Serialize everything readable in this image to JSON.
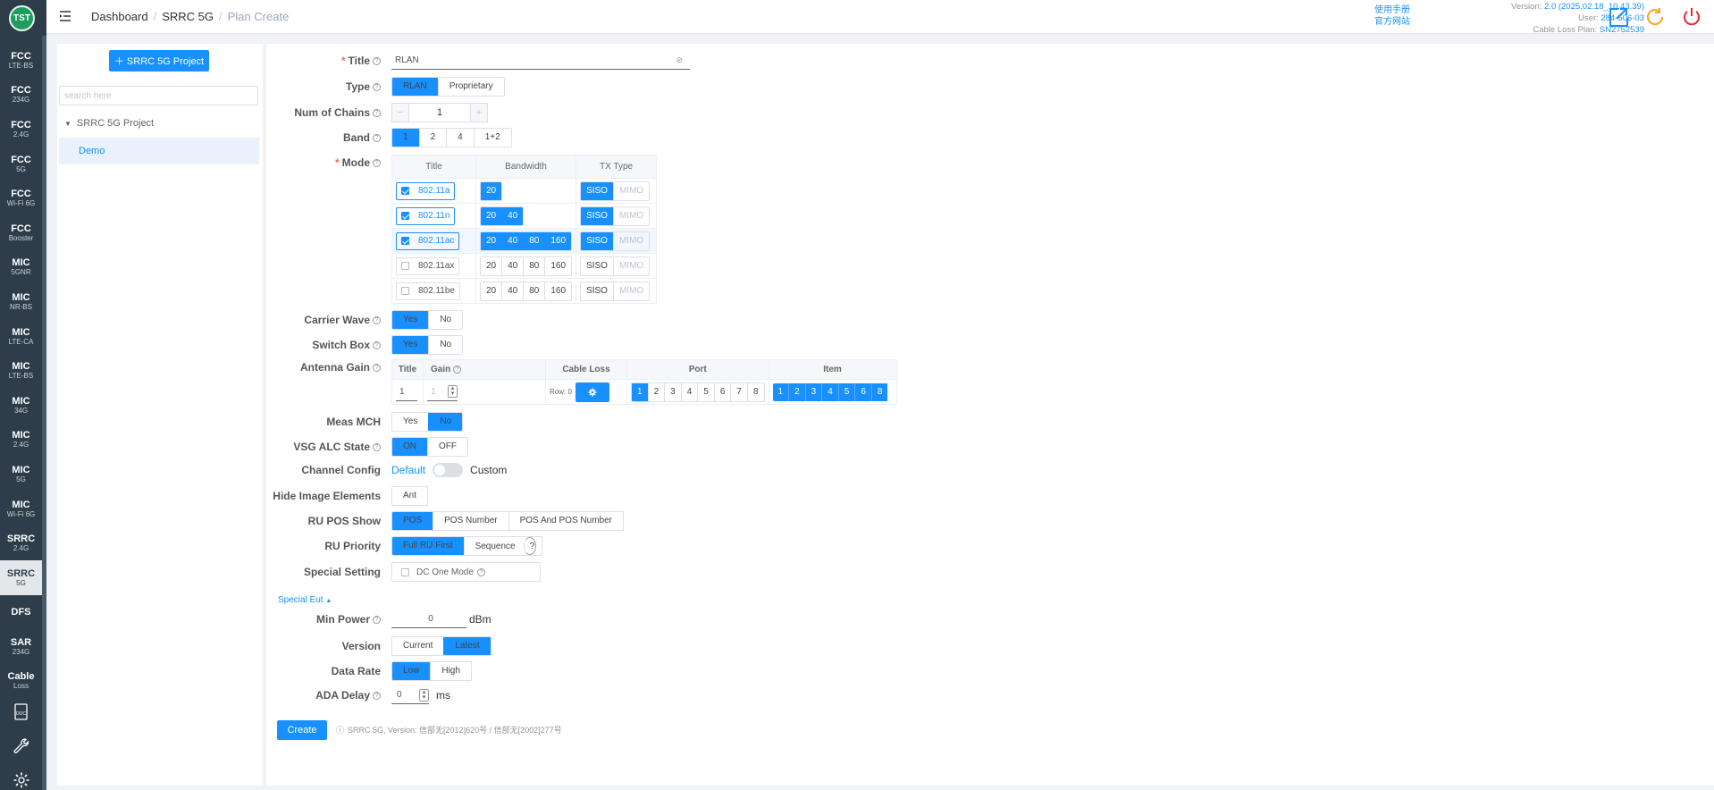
{
  "app": {
    "logo": "TST"
  },
  "nav": {
    "items": [
      {
        "l1": "FCC",
        "l2": "LTE-BS"
      },
      {
        "l1": "FCC",
        "l2": "234G"
      },
      {
        "l1": "FCC",
        "l2": "2.4G"
      },
      {
        "l1": "FCC",
        "l2": "5G"
      },
      {
        "l1": "FCC",
        "l2": "Wi-Fi 6G"
      },
      {
        "l1": "FCC",
        "l2": "Booster"
      },
      {
        "l1": "MIC",
        "l2": "5GNR"
      },
      {
        "l1": "MIC",
        "l2": "NR-BS"
      },
      {
        "l1": "MIC",
        "l2": "LTE-CA"
      },
      {
        "l1": "MIC",
        "l2": "LTE-BS"
      },
      {
        "l1": "MIC",
        "l2": "34G"
      },
      {
        "l1": "MIC",
        "l2": "2.4G"
      },
      {
        "l1": "MIC",
        "l2": "5G"
      },
      {
        "l1": "MIC",
        "l2": "Wi-Fi 6G"
      },
      {
        "l1": "SRRC",
        "l2": "2.4G"
      },
      {
        "l1": "SRRC",
        "l2": "5G"
      },
      {
        "l1": "DFS",
        "l2": ""
      },
      {
        "l1": "SAR",
        "l2": "234G"
      },
      {
        "l1": "Cable",
        "l2": "Loss"
      }
    ],
    "icons": [
      "doc-icon",
      "wrench-icon",
      "gear-icon"
    ],
    "doc_label": "DOC"
  },
  "header": {
    "breadcrumb": [
      "Dashboard",
      "SRRC 5G",
      "Plan Create"
    ],
    "links": [
      "使用手册",
      "官方网站"
    ],
    "meta": [
      {
        "k": "Version:",
        "v": "2.0 (2025.02.18_10.43.39)"
      },
      {
        "k": "User:",
        "v": "284-506-03"
      },
      {
        "k": "Cable Loss Plan:",
        "v": "SN2752539"
      }
    ]
  },
  "tree": {
    "add_label": "SRRC 5G Project",
    "search_placeholder": "search here",
    "node": "SRRC 5G Project",
    "leaf": "Demo"
  },
  "form": {
    "title": {
      "label": "Title",
      "value": "RLAN"
    },
    "type": {
      "label": "Type",
      "options": [
        "RLAN",
        "Proprietary"
      ],
      "selected": 0
    },
    "chains": {
      "label": "Num of Chains",
      "value": "1"
    },
    "band": {
      "label": "Band",
      "options": [
        "1",
        "2",
        "4",
        "1+2"
      ],
      "selected": 0
    },
    "mode": {
      "label": "Mode",
      "headers": [
        "Title",
        "Bandwidth",
        "TX Type"
      ],
      "rows": [
        {
          "title": "802.11a",
          "checked": true,
          "bw": [
            "20"
          ],
          "bw_on": [
            true
          ],
          "tx_on": [
            true,
            false
          ]
        },
        {
          "title": "802.11n",
          "checked": true,
          "bw": [
            "20",
            "40"
          ],
          "bw_on": [
            true,
            true
          ],
          "tx_on": [
            true,
            false
          ]
        },
        {
          "title": "802.11ac",
          "checked": true,
          "bw": [
            "20",
            "40",
            "80",
            "160"
          ],
          "bw_on": [
            true,
            true,
            true,
            true
          ],
          "tx_on": [
            true,
            false
          ]
        },
        {
          "title": "802.11ax",
          "checked": false,
          "bw": [
            "20",
            "40",
            "80",
            "160"
          ],
          "bw_on": [
            false,
            false,
            false,
            false
          ],
          "tx_on": [
            false,
            false
          ]
        },
        {
          "title": "802.11be",
          "checked": false,
          "bw": [
            "20",
            "40",
            "80",
            "160"
          ],
          "bw_on": [
            false,
            false,
            false,
            false
          ],
          "tx_on": [
            false,
            false
          ]
        }
      ],
      "tx_types": [
        "SISO",
        "MIMO"
      ]
    },
    "carrier": {
      "label": "Carrier Wave",
      "options": [
        "Yes",
        "No"
      ],
      "selected": 0
    },
    "switchbox": {
      "label": "Switch Box",
      "options": [
        "Yes",
        "No"
      ],
      "selected": 0
    },
    "antenna": {
      "label": "Antenna Gain",
      "headers": [
        "Title",
        "Gain",
        "Cable Loss",
        "Port",
        "Item"
      ],
      "row": {
        "title": "1",
        "gain": "1",
        "row_label": "Row: 0"
      },
      "ports": [
        "1",
        "2",
        "3",
        "4",
        "5",
        "6",
        "7",
        "8"
      ],
      "items": [
        "1",
        "2",
        "3",
        "4",
        "5",
        "6",
        "8"
      ]
    },
    "meas": {
      "label": "Meas MCH",
      "options": [
        "Yes",
        "No"
      ],
      "selected": 1
    },
    "vsg": {
      "label": "VSG ALC State",
      "options": [
        "ON",
        "OFF"
      ],
      "selected": 0
    },
    "channel": {
      "label": "Channel Config",
      "left": "Default",
      "right": "Custom"
    },
    "hide": {
      "label": "Hide Image Elements",
      "options": [
        "Ant"
      ]
    },
    "ru_pos": {
      "label": "RU POS Show",
      "options": [
        "POS",
        "POS Number",
        "POS And POS Number"
      ],
      "selected": 0
    },
    "ru_pri": {
      "label": "RU Priority",
      "options": [
        "Full RU First",
        "Sequence"
      ],
      "selected": 0
    },
    "special": {
      "label": "Special Setting",
      "option": "DC One Mode"
    },
    "special_eut": "Special Eut",
    "min_power": {
      "label": "Min Power",
      "value": "0",
      "unit": "dBm"
    },
    "version": {
      "label": "Version",
      "options": [
        "Current",
        "Latest"
      ],
      "selected": 1
    },
    "data_rate": {
      "label": "Data Rate",
      "options": [
        "Low",
        "High"
      ],
      "selected": 0
    },
    "ada": {
      "label": "ADA Delay",
      "value": "0",
      "unit": "ms"
    },
    "create": "Create",
    "note": "SRRC 5G, Version: 信部无[2012]620号 / 信部无[2002]277号"
  }
}
